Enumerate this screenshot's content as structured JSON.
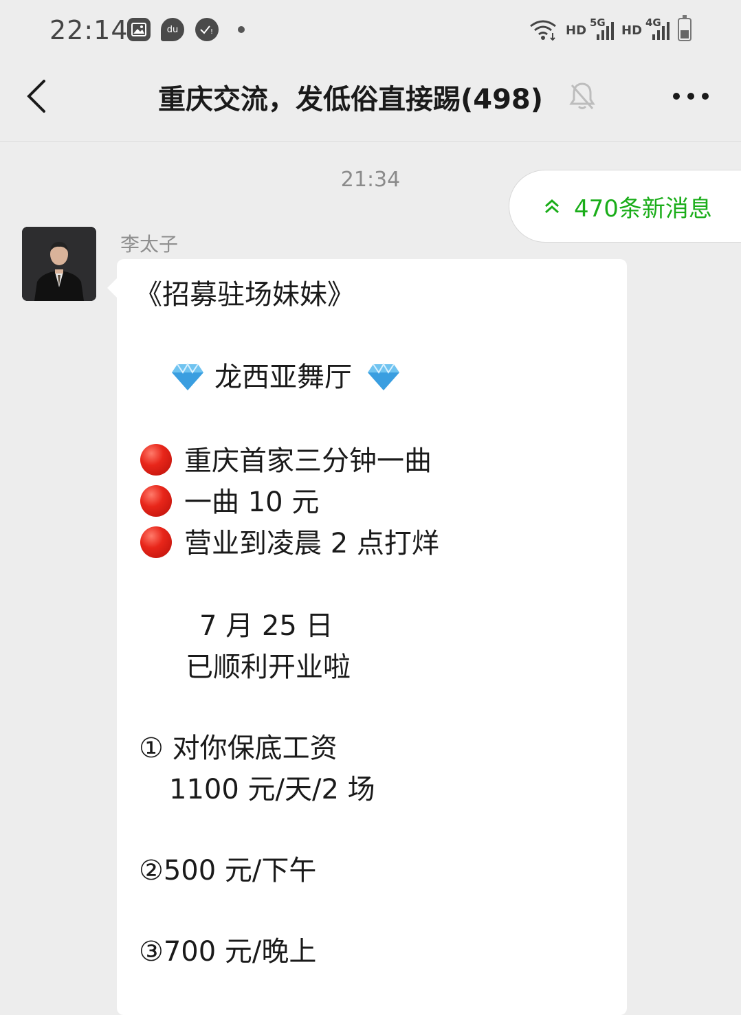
{
  "status_bar": {
    "time": "22:14",
    "right_labels": [
      "HD",
      "5G",
      "HD",
      "4G"
    ],
    "icons": [
      "image-icon",
      "baidu-du-icon",
      "app-check-icon",
      "notification-dot-icon",
      "wifi-icon",
      "signal-5g-icon",
      "signal-4g-icon",
      "battery-icon"
    ]
  },
  "header": {
    "title": "重庆交流，发低俗直接踢(498)",
    "back_icon": "chevron-left-icon",
    "mute_icon": "bell-off-icon",
    "more_icon": "more-dots-icon"
  },
  "chat": {
    "timestamp": "21:34",
    "new_messages_pill": "470条新消息",
    "message": {
      "sender": "李太子",
      "lines": [
        "《招募驻场妹妹》",
        "龙西亚舞厅",
        "重庆首家三分钟一曲",
        "一曲 10 元",
        "营业到凌晨 2 点打烊",
        "7 月 25 日",
        "已顺利开业啦",
        "① 对你保底工资",
        "1100 元/天/2 场",
        "②500 元/下午",
        "③700 元/晚上"
      ]
    }
  },
  "colors": {
    "background": "#ededed",
    "bubble": "#ffffff",
    "accent_green": "#1aad19",
    "text": "#1a1a1a",
    "muted_text": "#8f8f8f"
  }
}
